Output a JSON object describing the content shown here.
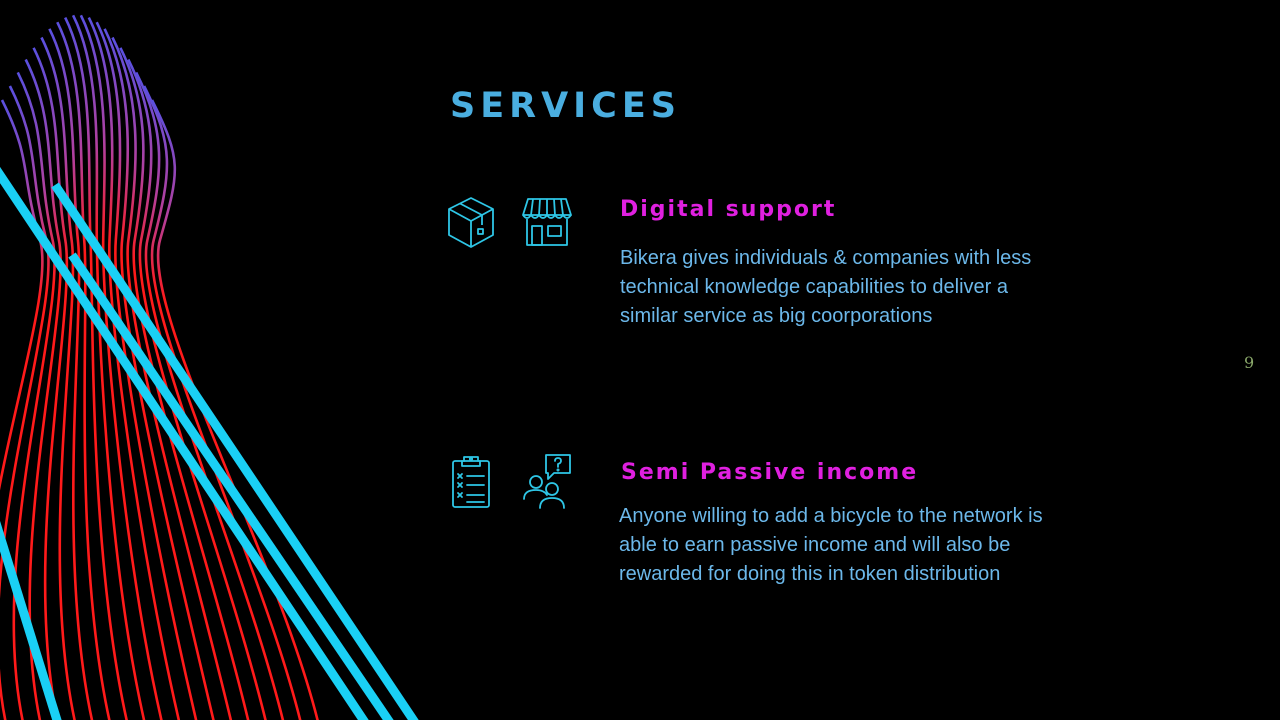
{
  "slide": {
    "title": "SERVICES",
    "page_number": "9",
    "colors": {
      "background": "#000000",
      "title": "#4aaee0",
      "heading": "#e020e0",
      "body": "#6cb8ea",
      "icon": "#2ec6e6",
      "wave_red": "#ff1a1a",
      "wave_purple": "#6a4fd8",
      "streak": "#1ad0f5",
      "page_number": "#8aa86a"
    }
  },
  "services": [
    {
      "heading": "Digital support",
      "body": "Bikera gives individuals & companies with less technical knowledge capabilities to deliver a similar service as big coorporations",
      "icons": [
        "package-box-icon",
        "storefront-icon"
      ]
    },
    {
      "heading": "Semi Passive income",
      "body": "Anyone willing to add a bicycle to the network is able to earn passive income and will also be rewarded for doing this in token distribution",
      "icons": [
        "checklist-clipboard-icon",
        "people-question-icon"
      ]
    }
  ]
}
